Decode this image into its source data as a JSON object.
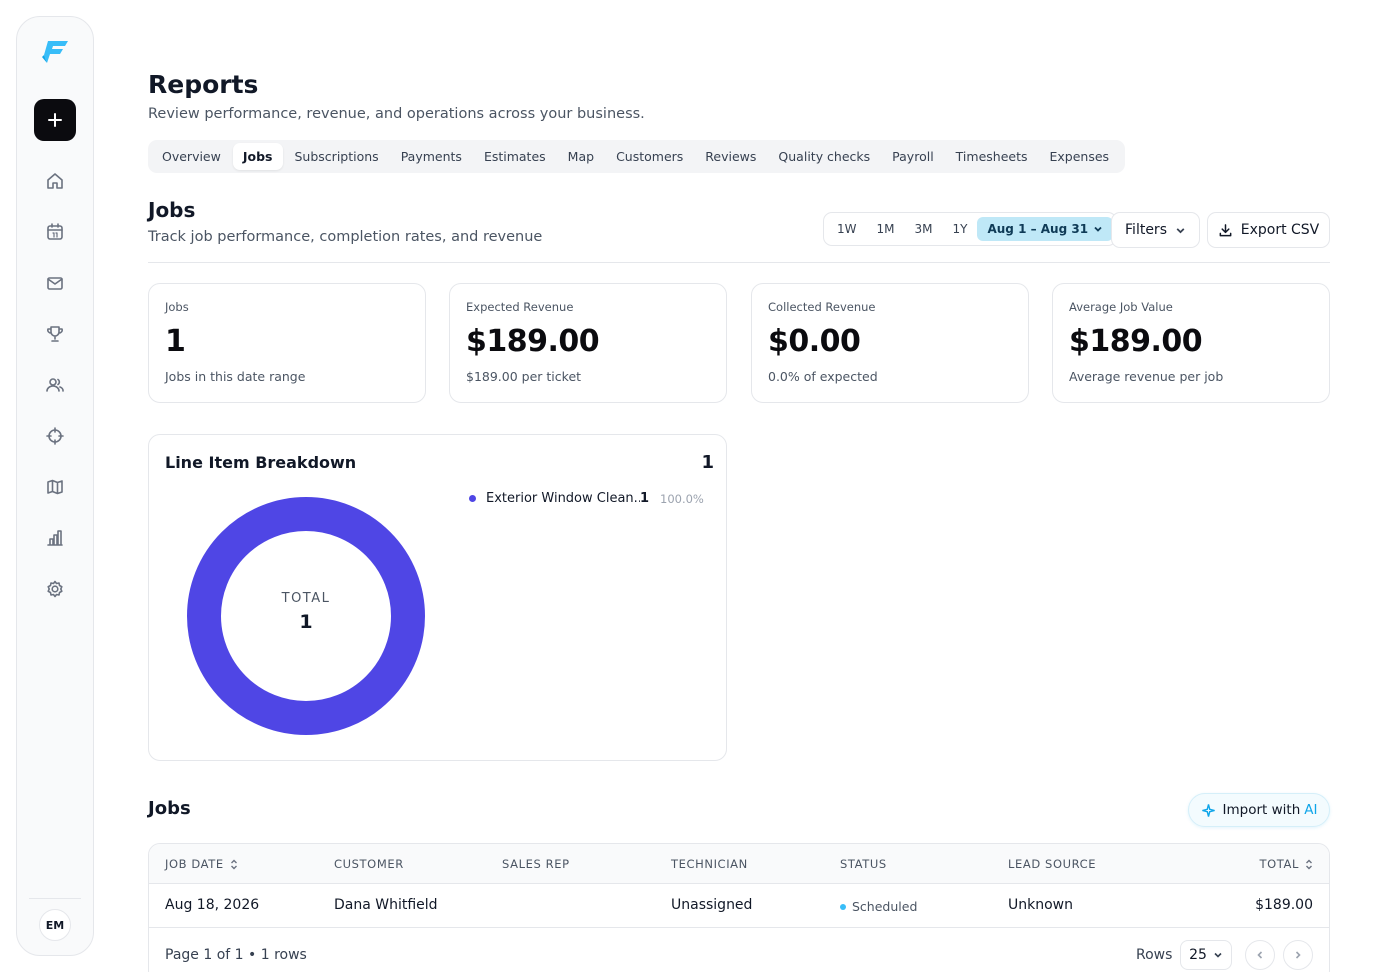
{
  "sidebar": {
    "avatar_initials": "EM",
    "nav": [
      "home-icon",
      "calendar-icon",
      "mail-icon",
      "trophy-icon",
      "users-icon",
      "crosshair-icon",
      "map-icon",
      "chart-icon",
      "gear-icon"
    ]
  },
  "header": {
    "title": "Reports",
    "subtitle": "Review performance, revenue, and operations across your business."
  },
  "tabs": [
    {
      "label": "Overview",
      "active": false
    },
    {
      "label": "Jobs",
      "active": true
    },
    {
      "label": "Subscriptions",
      "active": false
    },
    {
      "label": "Payments",
      "active": false
    },
    {
      "label": "Estimates",
      "active": false
    },
    {
      "label": "Map",
      "active": false
    },
    {
      "label": "Customers",
      "active": false
    },
    {
      "label": "Reviews",
      "active": false
    },
    {
      "label": "Quality checks",
      "active": false
    },
    {
      "label": "Payroll",
      "active": false
    },
    {
      "label": "Timesheets",
      "active": false
    },
    {
      "label": "Expenses",
      "active": false
    }
  ],
  "section": {
    "title": "Jobs",
    "subtitle": "Track job performance, completion rates, and revenue"
  },
  "range": {
    "options": [
      "1W",
      "1M",
      "3M",
      "1Y"
    ],
    "selected": "Aug 1 – Aug 31"
  },
  "toolbar": {
    "filters_label": "Filters",
    "export_label": "Export CSV"
  },
  "stats": [
    {
      "label": "Jobs",
      "value": "1",
      "sub": "Jobs in this date range"
    },
    {
      "label": "Expected Revenue",
      "value": "$189.00",
      "sub": "$189.00 per ticket"
    },
    {
      "label": "Collected Revenue",
      "value": "$0.00",
      "sub": "0.0% of expected"
    },
    {
      "label": "Average Job Value",
      "value": "$189.00",
      "sub": "Average revenue per job"
    }
  ],
  "breakdown": {
    "title": "Line Item Breakdown",
    "count": "1",
    "center_label": "TOTAL",
    "center_value": "1",
    "items": [
      {
        "name": "Exterior Window Clean...",
        "count": "1",
        "pct": "100.0%",
        "fraction": 1.0
      }
    ],
    "color": "#4f46e5"
  },
  "jobs": {
    "title": "Jobs",
    "import_label": "Import with",
    "import_accent": "AI",
    "columns": [
      "JOB DATE",
      "CUSTOMER",
      "SALES REP",
      "TECHNICIAN",
      "STATUS",
      "LEAD SOURCE",
      "TOTAL"
    ],
    "rows": [
      {
        "job_date": "Aug 18, 2026",
        "customer": "Dana Whitfield",
        "sales_rep": "",
        "technician": "Unassigned",
        "status": "Scheduled",
        "lead_source": "Unknown",
        "total": "$189.00"
      }
    ],
    "page_info": "Page 1 of 1 • 1 rows",
    "rows_label": "Rows",
    "rows_per_page": "25",
    "status_color": "#38bdf8"
  }
}
